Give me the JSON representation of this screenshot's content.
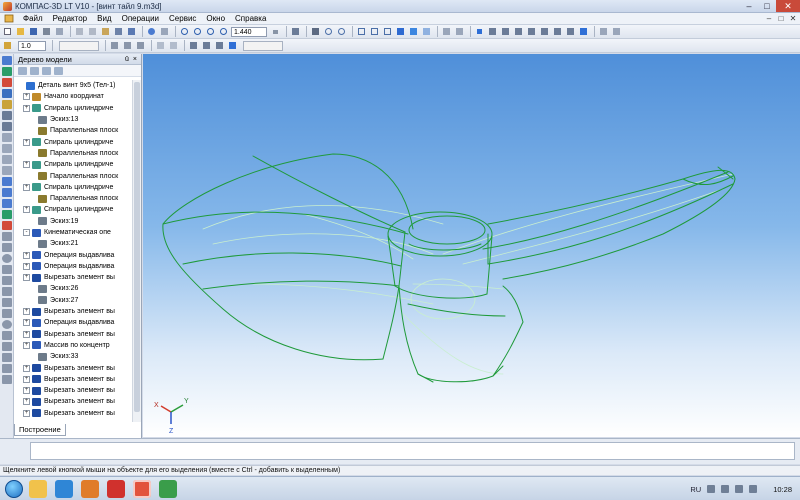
{
  "window": {
    "title": "КОМПАС-3D LT V10 - [винт тайл 9.m3d]",
    "min": "–",
    "max": "□",
    "close": "✕"
  },
  "menu": {
    "items": [
      "Файл",
      "Редактор",
      "Вид",
      "Операции",
      "Сервис",
      "Окно",
      "Справка"
    ]
  },
  "toolbar": {
    "zoom_value": "1.440",
    "scale_value": "1.0"
  },
  "tree": {
    "title": "Дерево модели",
    "title_buttons": [
      "ū",
      "×"
    ],
    "tab_label": "Построение",
    "items": [
      {
        "label": "Деталь винт 9х5 (Тел-1)",
        "expander": "",
        "icon": "part-icon",
        "color": "#2d6fd0",
        "indent": 0
      },
      {
        "label": "Начало координат",
        "expander": "+",
        "icon": "origin-icon",
        "color": "#c08a2a",
        "indent": 1
      },
      {
        "label": "Спираль цилиндриче",
        "expander": "+",
        "icon": "spiral-icon",
        "color": "#3a9a8a",
        "indent": 1
      },
      {
        "label": "Эскиз:13",
        "expander": "",
        "icon": "sketch-icon",
        "color": "#6d7b8a",
        "indent": 2
      },
      {
        "label": "Параллельная плоск",
        "expander": "",
        "icon": "plane-icon",
        "color": "#8a7a2e",
        "indent": 2
      },
      {
        "label": "Спираль цилиндриче",
        "expander": "+",
        "icon": "spiral-icon",
        "color": "#3a9a8a",
        "indent": 1
      },
      {
        "label": "Параллельная плоск",
        "expander": "",
        "icon": "plane-icon",
        "color": "#8a7a2e",
        "indent": 2
      },
      {
        "label": "Спираль цилиндриче",
        "expander": "+",
        "icon": "spiral-icon",
        "color": "#3a9a8a",
        "indent": 1
      },
      {
        "label": "Параллельная плоск",
        "expander": "",
        "icon": "plane-icon",
        "color": "#8a7a2e",
        "indent": 2
      },
      {
        "label": "Спираль цилиндриче",
        "expander": "+",
        "icon": "spiral-icon",
        "color": "#3a9a8a",
        "indent": 1
      },
      {
        "label": "Параллельная плоск",
        "expander": "",
        "icon": "plane-icon",
        "color": "#8a7a2e",
        "indent": 2
      },
      {
        "label": "Спираль цилиндриче",
        "expander": "+",
        "icon": "spiral-icon",
        "color": "#3a9a8a",
        "indent": 1
      },
      {
        "label": "Эскиз:19",
        "expander": "",
        "icon": "sketch-icon",
        "color": "#6d7b8a",
        "indent": 2
      },
      {
        "label": "Кинематическая опе",
        "expander": "-",
        "icon": "kinematic-icon",
        "color": "#2b59b8",
        "indent": 1
      },
      {
        "label": "Эскиз:21",
        "expander": "",
        "icon": "sketch-icon",
        "color": "#6d7b8a",
        "indent": 2
      },
      {
        "label": "Операция выдавлива",
        "expander": "+",
        "icon": "extrude-icon",
        "color": "#2b59b8",
        "indent": 1
      },
      {
        "label": "Операция выдавлива",
        "expander": "+",
        "icon": "extrude-icon",
        "color": "#2b59b8",
        "indent": 1
      },
      {
        "label": "Вырезать элемент вы",
        "expander": "+",
        "icon": "cut-icon",
        "color": "#1e4aa0",
        "indent": 1
      },
      {
        "label": "Эскиз:26",
        "expander": "",
        "icon": "sketch-icon",
        "color": "#6d7b8a",
        "indent": 2
      },
      {
        "label": "Эскиз:27",
        "expander": "",
        "icon": "sketch-icon",
        "color": "#6d7b8a",
        "indent": 2
      },
      {
        "label": "Вырезать элемент вы",
        "expander": "+",
        "icon": "cut-icon",
        "color": "#1e4aa0",
        "indent": 1
      },
      {
        "label": "Операция выдавлива",
        "expander": "+",
        "icon": "extrude-icon",
        "color": "#2b59b8",
        "indent": 1
      },
      {
        "label": "Вырезать элемент вы",
        "expander": "+",
        "icon": "cut-icon",
        "color": "#1e4aa0",
        "indent": 1
      },
      {
        "label": "Массив по концентр",
        "expander": "+",
        "icon": "array-icon",
        "color": "#2b59b8",
        "indent": 1
      },
      {
        "label": "Эскиз:33",
        "expander": "",
        "icon": "sketch-icon",
        "color": "#6d7b8a",
        "indent": 2
      },
      {
        "label": "Вырезать элемент вы",
        "expander": "+",
        "icon": "cut-icon",
        "color": "#1e4aa0",
        "indent": 1
      },
      {
        "label": "Вырезать элемент вы",
        "expander": "+",
        "icon": "cut-icon",
        "color": "#1e4aa0",
        "indent": 1
      },
      {
        "label": "Вырезать элемент вы",
        "expander": "+",
        "icon": "cut-icon",
        "color": "#1e4aa0",
        "indent": 1
      },
      {
        "label": "Вырезать элемент вы",
        "expander": "+",
        "icon": "cut-icon",
        "color": "#1e4aa0",
        "indent": 1
      },
      {
        "label": "Вырезать элемент вы",
        "expander": "+",
        "icon": "cut-icon",
        "color": "#1e4aa0",
        "indent": 1
      }
    ]
  },
  "axes": {
    "x": "X",
    "y": "Y",
    "z": "Z"
  },
  "status": {
    "text": "Щелкните левой кнопкой мыши на объекте для его выделения (вместе с Ctrl - добавить к выделенным)"
  },
  "taskbar": {
    "apps": [
      {
        "name": "explorer-task-icon",
        "color": "#f1c24b"
      },
      {
        "name": "ie-task-icon",
        "color": "#2f86d6"
      },
      {
        "name": "media-task-icon",
        "color": "#e07c2a"
      },
      {
        "name": "opera-task-icon",
        "color": "#d0312d"
      },
      {
        "name": "kompas-task-icon",
        "color": "#e2533c"
      },
      {
        "name": "chrome-task-icon",
        "color": "#3a9d4a"
      }
    ],
    "lang": "RU",
    "clock": "10:28"
  },
  "colors": {
    "wireframe": "#1f9a3a",
    "wireframe_light": "#bfe8c6"
  }
}
